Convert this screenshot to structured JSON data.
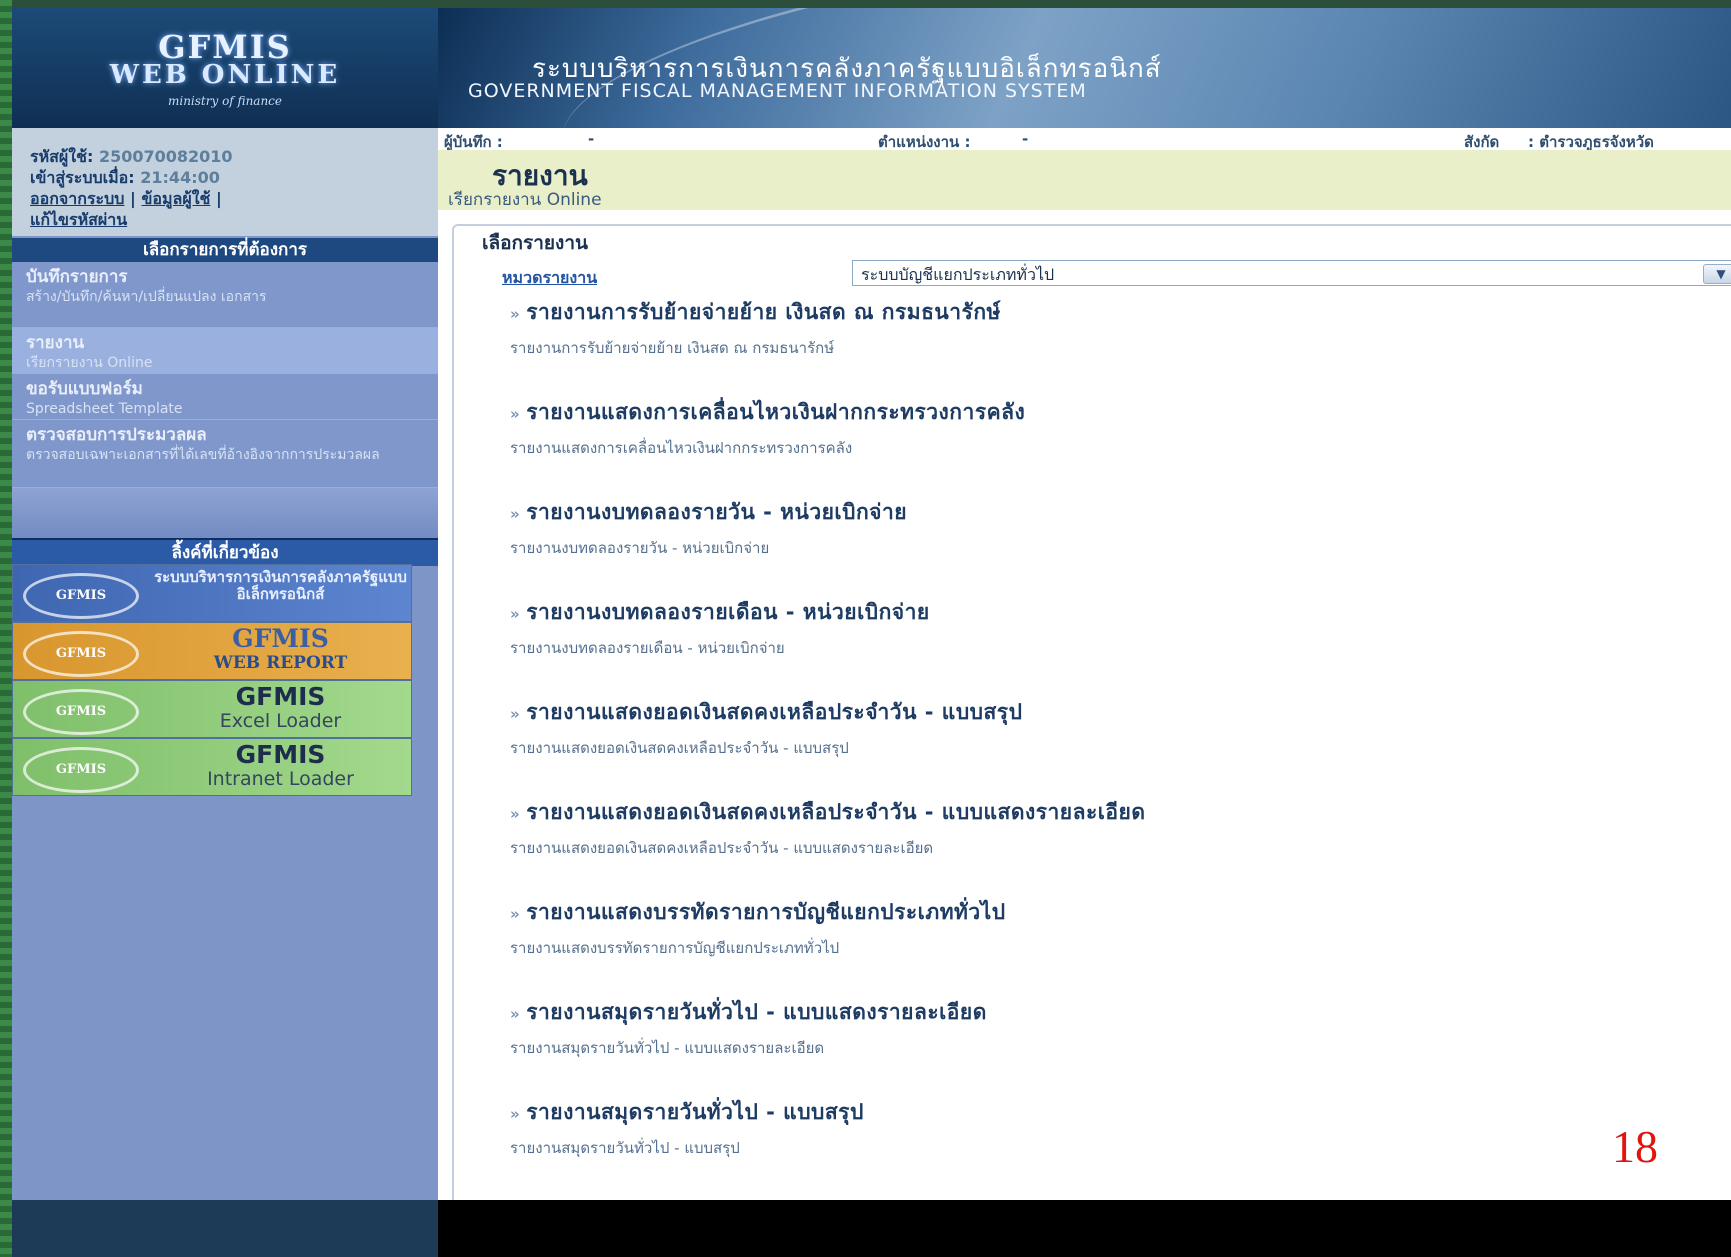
{
  "logo": {
    "line1": "GFMIS",
    "line2": "WEB ONLINE",
    "line3": "ministry of finance"
  },
  "banner": {
    "title_th": "ระบบบริหารการเงินการคลังภาครัฐแบบอิเล็กทรอนิกส์",
    "title_en": "GOVERNMENT FISCAL MANAGEMENT INFORMATION SYSTEM"
  },
  "user": {
    "id_label": "รหัสผู้ใช้:",
    "id_value": "250070082010",
    "login_label": "เข้าสู่ระบบเมื่อ:",
    "login_time": "21:44:00",
    "logout_link": "ออกจากระบบ",
    "userinfo_link": "ข้อมูลผู้ใช้",
    "changepw_link": "แก้ไขรหัสผ่าน"
  },
  "menu": {
    "title": "เลือกรายการที่ต้องการ",
    "items": [
      {
        "label": "บันทึกรายการ",
        "sub": "สร้าง/บันทึก/ค้นหา/เปลี่ยนแปลง เอกสาร"
      },
      {
        "label": "รายงาน",
        "sub": "เรียกรายงาน Online"
      },
      {
        "label": "ขอรับแบบฟอร์ม",
        "sub": "Spreadsheet Template"
      },
      {
        "label": "ตรวจสอบการประมวลผล",
        "sub": "ตรวจสอบเฉพาะเอกสารที่ได้เลขที่อ้างอิงจากการประมวลผล"
      }
    ]
  },
  "links": {
    "title": "ลิ้งค์ที่เกี่ยวข้อง",
    "items": [
      {
        "badge": "GFMIS",
        "label": "ระบบบริหารการเงินการคลังภาครัฐแบบอิเล็กทรอนิกส์",
        "sub": ""
      },
      {
        "badge": "GFMIS",
        "label": "GFMIS",
        "sub": "WEB REPORT"
      },
      {
        "badge": "GFMIS",
        "label": "GFMIS",
        "sub": "Excel Loader"
      },
      {
        "badge": "GFMIS",
        "label": "GFMIS",
        "sub": "Intranet Loader"
      }
    ]
  },
  "meta": {
    "recorder_label": "ผู้บันทึก :",
    "recorder_value": "-",
    "position_label": "ตำแหน่งงาน :",
    "position_value": "-",
    "org_label": "สังกัด",
    "org_value": ": ตำรวจภูธรจังหวัด"
  },
  "page": {
    "title": "รายงาน",
    "subtitle": "เรียกรายงาน Online",
    "section": "เลือกรายงาน",
    "category_label": "หมวดรายงาน",
    "category_value": "ระบบบัญชีแยกประเภททั่วไป"
  },
  "reports": [
    {
      "title": "รายงานการรับย้ายจ่ายย้าย เงินสด ณ กรมธนารักษ์",
      "desc": "รายงานการรับย้ายจ่ายย้าย เงินสด ณ กรมธนารักษ์"
    },
    {
      "title": "รายงานแสดงการเคลื่อนไหวเงินฝากกระทรวงการคลัง",
      "desc": "รายงานแสดงการเคลื่อนไหวเงินฝากกระทรวงการคลัง"
    },
    {
      "title": "รายงานงบทดลองรายวัน - หน่วยเบิกจ่าย",
      "desc": "รายงานงบทดลองรายวัน - หน่วยเบิกจ่าย"
    },
    {
      "title": "รายงานงบทดลองรายเดือน - หน่วยเบิกจ่าย",
      "desc": "รายงานงบทดลองรายเดือน - หน่วยเบิกจ่าย"
    },
    {
      "title": "รายงานแสดงยอดเงินสดคงเหลือประจำวัน - แบบสรุป",
      "desc": "รายงานแสดงยอดเงินสดคงเหลือประจำวัน - แบบสรุป"
    },
    {
      "title": "รายงานแสดงยอดเงินสดคงเหลือประจำวัน - แบบแสดงรายละเอียด",
      "desc": "รายงานแสดงยอดเงินสดคงเหลือประจำวัน - แบบแสดงรายละเอียด"
    },
    {
      "title": "รายงานแสดงบรรทัดรายการบัญชีแยกประเภททั่วไป",
      "desc": "รายงานแสดงบรรทัดรายการบัญชีแยกประเภททั่วไป"
    },
    {
      "title": "รายงานสมุดรายวันทั่วไป - แบบแสดงรายละเอียด",
      "desc": "รายงานสมุดรายวันทั่วไป - แบบแสดงรายละเอียด"
    },
    {
      "title": "รายงานสมุดรายวันทั่วไป - แบบสรุป",
      "desc": "รายงานสมุดรายวันทั่วไป - แบบสรุป"
    }
  ],
  "slide_number": "18"
}
